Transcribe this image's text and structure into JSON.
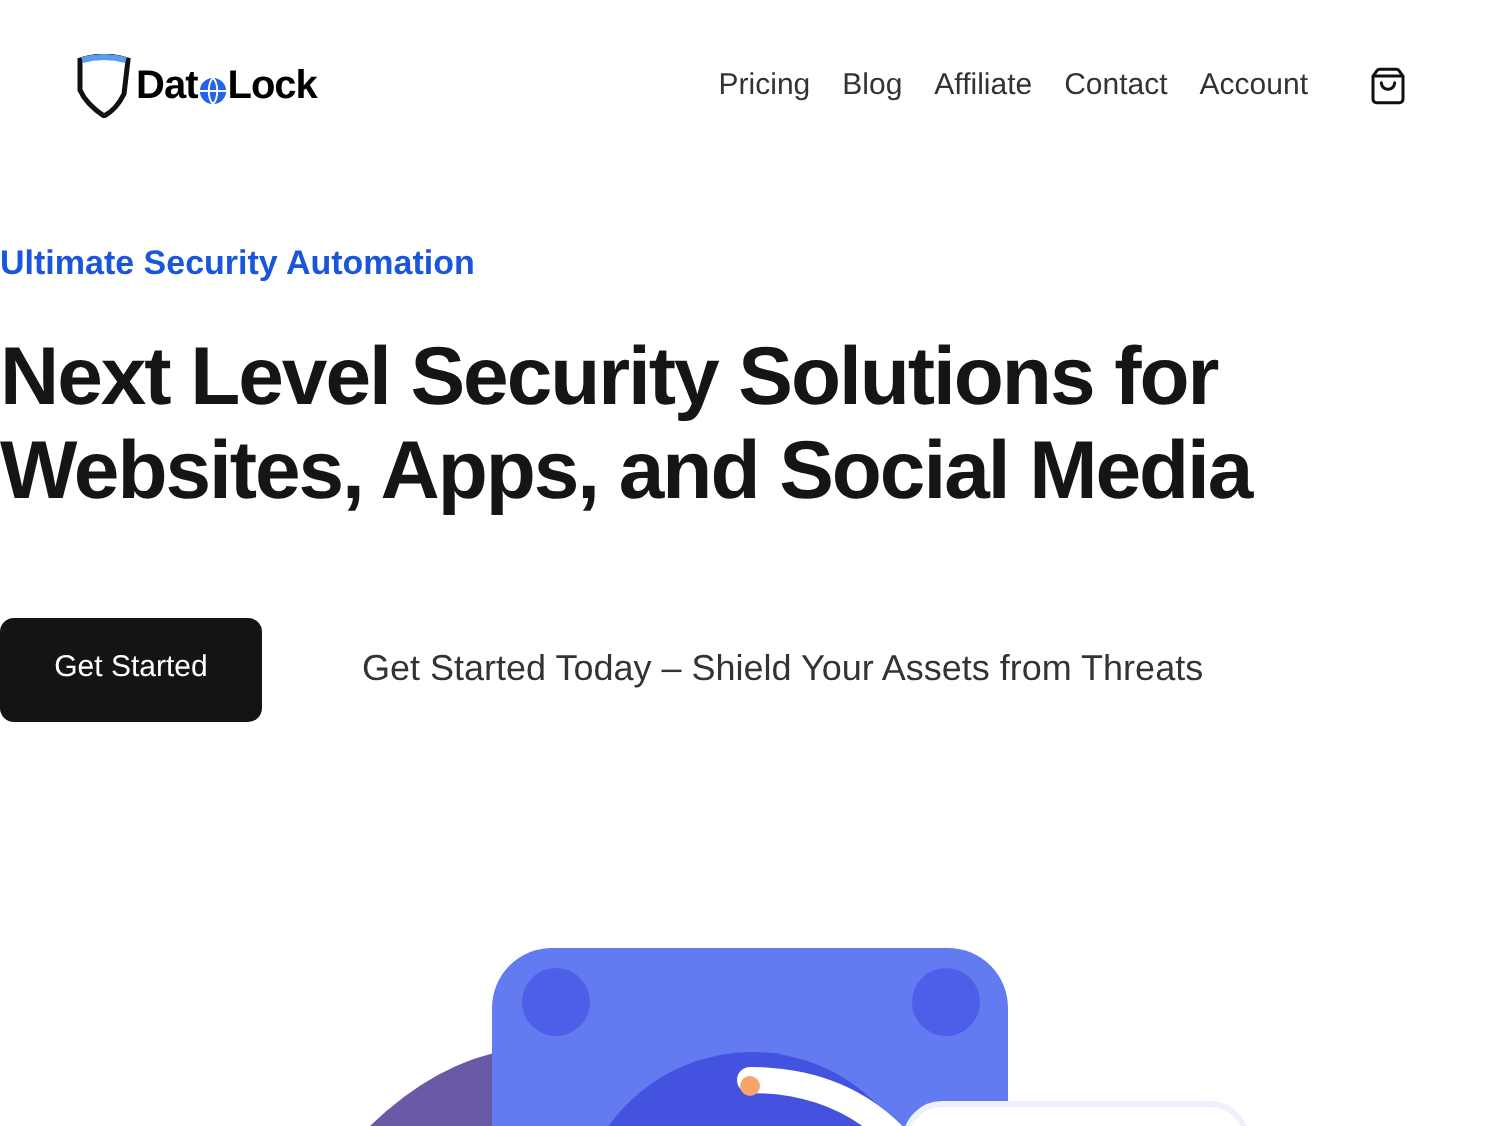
{
  "header": {
    "logo": {
      "part_1": "Dat",
      "part_2": "Lock"
    },
    "nav": [
      "Pricing",
      "Blog",
      "Affiliate",
      "Contact",
      "Account"
    ]
  },
  "hero": {
    "eyebrow": "Ultimate Security Automation",
    "title_lines": [
      "Next Level Security Solutions for",
      "Websites, Apps, and Social Media"
    ],
    "button": "Get Started",
    "tagline": "Get Started Today – Shield Your Assets from Threats"
  }
}
